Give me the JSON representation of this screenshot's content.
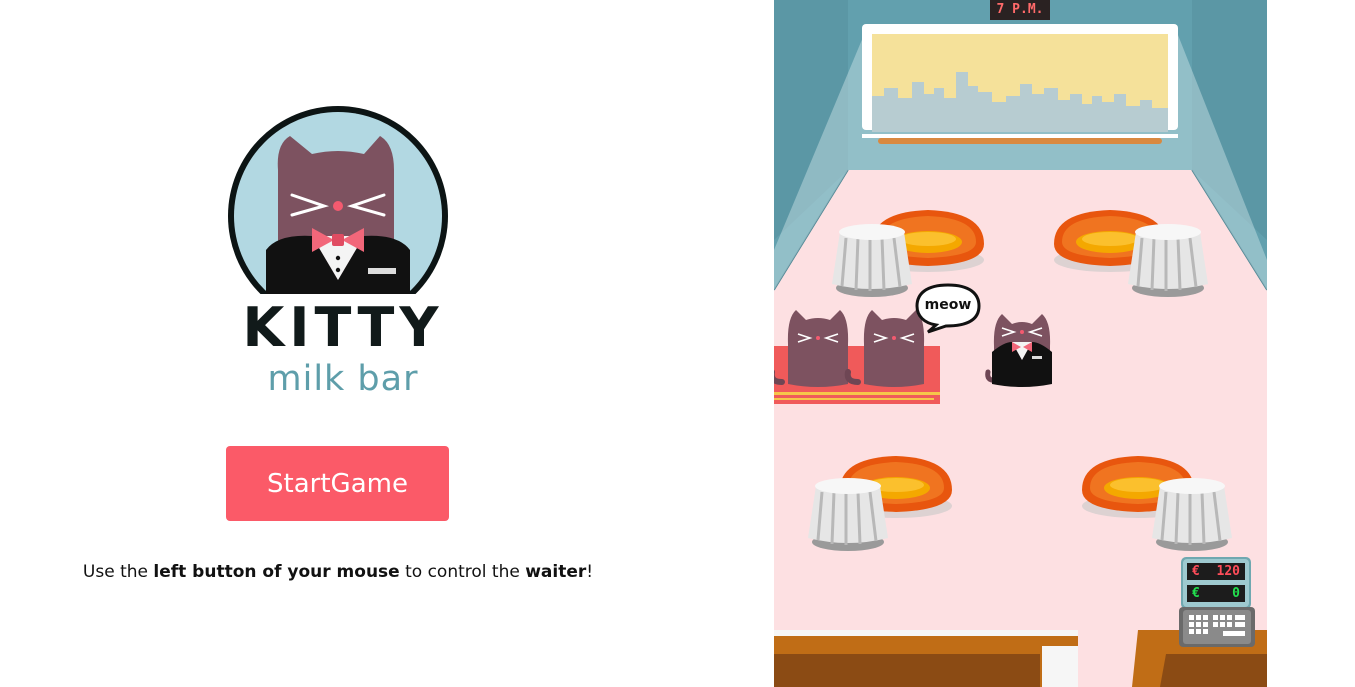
{
  "logo": {
    "title": "KITTY",
    "subtitle": "milk bar"
  },
  "start_button": {
    "label": "StartGame"
  },
  "instructions": {
    "prefix": "Use the ",
    "bold_1": "left button of your mouse",
    "middle": " to control the ",
    "bold_2": "waiter",
    "suffix": "!"
  },
  "game": {
    "clock": "7 P.M.",
    "speech": "meow",
    "register": {
      "currency": "€",
      "total": "120",
      "tips": "0"
    }
  },
  "colors": {
    "button": "#fb5a68",
    "floor": "#fde0e2",
    "wall": "#62a0ae",
    "subtitle": "#5e9eaa"
  }
}
